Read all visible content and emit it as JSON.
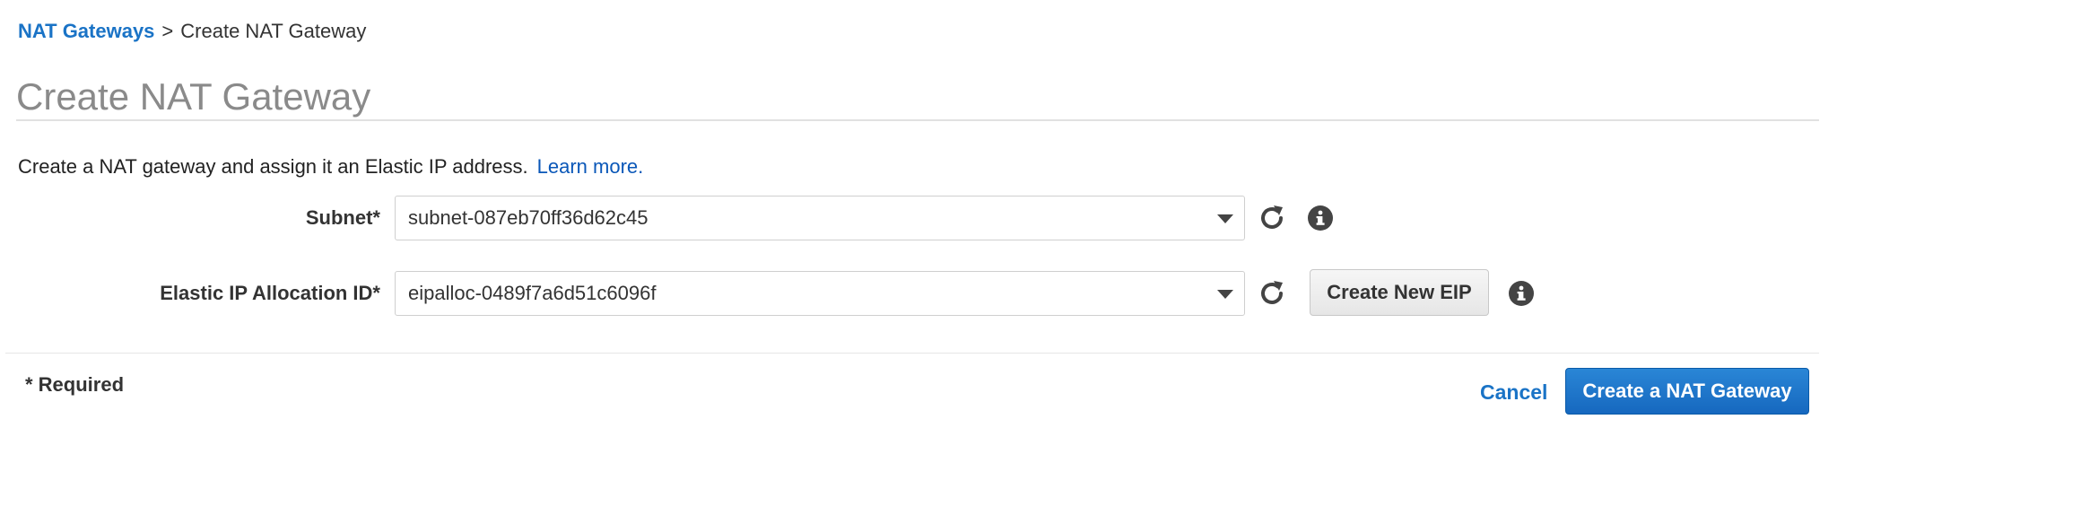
{
  "breadcrumb": {
    "parent_label": "NAT Gateways",
    "separator": ">",
    "current_label": "Create NAT Gateway"
  },
  "page": {
    "title": "Create NAT Gateway",
    "description": "Create a NAT gateway and assign it an Elastic IP address.",
    "learn_more_label": "Learn more."
  },
  "form": {
    "subnet": {
      "label": "Subnet*",
      "value": "subnet-087eb70ff36d62c45"
    },
    "elastic_ip": {
      "label": "Elastic IP Allocation ID*",
      "value": "eipalloc-0489f7a6d51c6096f",
      "create_button_label": "Create New EIP"
    }
  },
  "footer": {
    "required_note": "* Required",
    "cancel_label": "Cancel",
    "submit_label": "Create a NAT Gateway"
  },
  "icons": {
    "refresh": "refresh-icon",
    "info": "info-icon",
    "dropdown": "chevron-down-icon"
  },
  "colors": {
    "link": "#1a73c6",
    "primary_button": "#1f77cf",
    "title_gray": "#8a8a8a"
  }
}
